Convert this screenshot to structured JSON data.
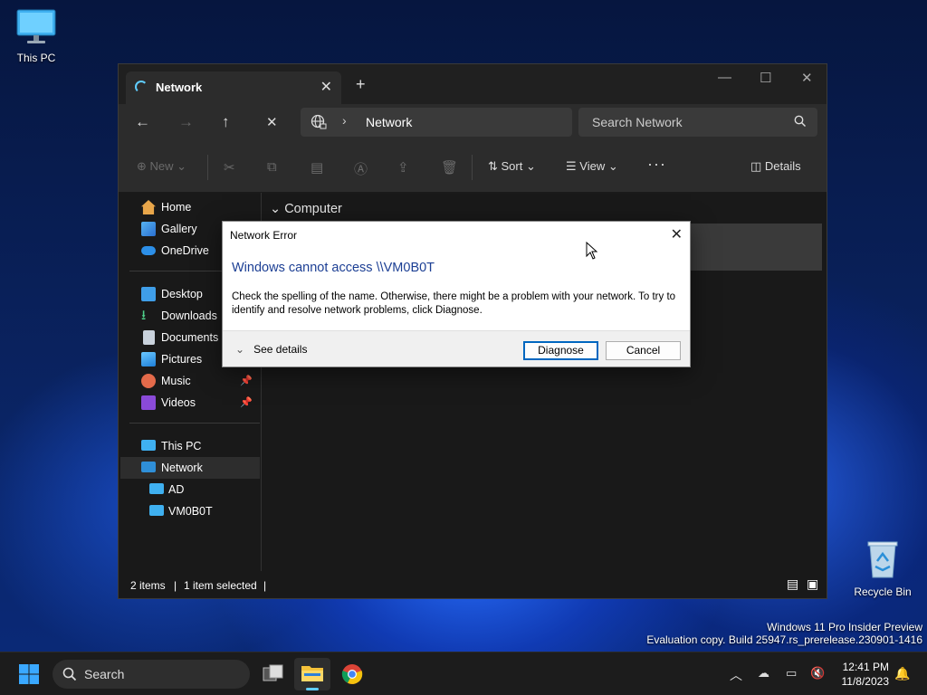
{
  "desktop": {
    "this_pc_label": "This PC",
    "recycle_bin_label": "Recycle Bin",
    "watermark_line1": "Windows 11 Pro Insider Preview",
    "watermark_line2": "Evaluation copy. Build 25947.rs_prerelease.230901-1416"
  },
  "explorer": {
    "tab_title": "Network",
    "address_text": "Network",
    "search_placeholder": "Search Network",
    "toolbar": {
      "new_label": "New",
      "sort_label": "Sort",
      "view_label": "View",
      "details_label": "Details"
    },
    "sidebar": {
      "home": "Home",
      "gallery": "Gallery",
      "onedrive": "OneDrive",
      "desktop": "Desktop",
      "downloads": "Downloads",
      "documents": "Documents",
      "pictures": "Pictures",
      "music": "Music",
      "videos": "Videos",
      "this_pc": "This PC",
      "network": "Network",
      "ad": "AD",
      "vm": "VM0B0T"
    },
    "content": {
      "group_label": "Computer"
    },
    "status": {
      "item_count": "2 items",
      "selected": "1 item selected"
    }
  },
  "dialog": {
    "title": "Network Error",
    "heading": "Windows cannot access \\\\VM0B0T",
    "message": "Check the spelling of the name. Otherwise, there might be a problem with your network. To try to identify and resolve network problems, click Diagnose.",
    "see_details": "See details",
    "diagnose_label": "Diagnose",
    "cancel_label": "Cancel"
  },
  "taskbar": {
    "search_label": "Search",
    "time": "12:41 PM",
    "date": "11/8/2023"
  },
  "colors": {
    "accent": "#60cdff",
    "dialog_heading": "#1c3f94",
    "primary_button_border": "#0067c0"
  }
}
